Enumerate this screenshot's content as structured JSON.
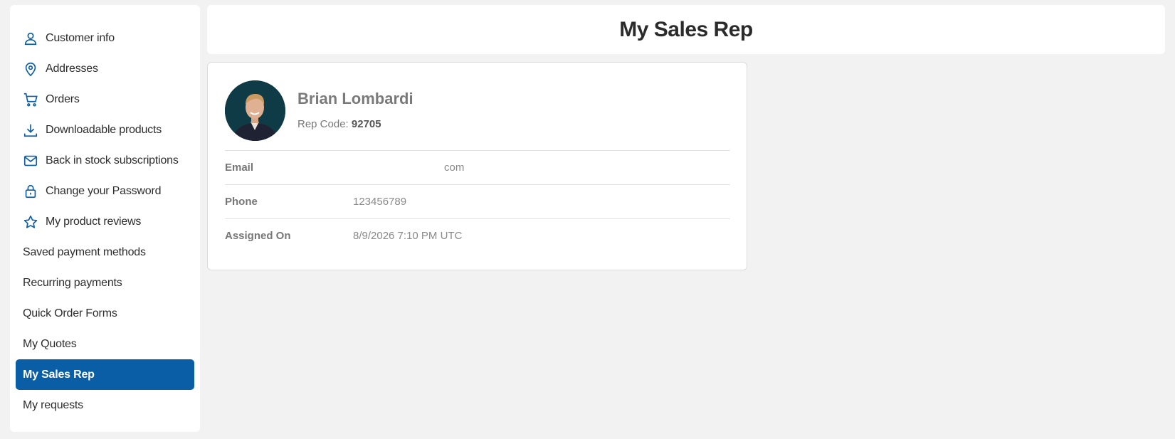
{
  "sidebar": {
    "items": [
      {
        "label": "Customer info",
        "icon": "person-icon"
      },
      {
        "label": "Addresses",
        "icon": "map-pin-icon"
      },
      {
        "label": "Orders",
        "icon": "cart-icon"
      },
      {
        "label": "Downloadable products",
        "icon": "download-icon"
      },
      {
        "label": "Back in stock subscriptions",
        "icon": "envelope-icon"
      },
      {
        "label": "Change your Password",
        "icon": "lock-icon"
      },
      {
        "label": "My product reviews",
        "icon": "star-icon"
      },
      {
        "label": "Saved payment methods",
        "icon": ""
      },
      {
        "label": "Recurring payments",
        "icon": ""
      },
      {
        "label": "Quick Order Forms",
        "icon": ""
      },
      {
        "label": "My Quotes",
        "icon": ""
      },
      {
        "label": "My Sales Rep",
        "icon": "",
        "active": true
      },
      {
        "label": "My requests",
        "icon": ""
      }
    ],
    "accent_color": "#0a5ea5"
  },
  "header": {
    "title": "My Sales Rep"
  },
  "rep": {
    "name": "Brian Lombardi",
    "code_label": "Rep Code:",
    "code": "92705",
    "details": [
      {
        "label": "Email",
        "value": "com"
      },
      {
        "label": "Phone",
        "value": "123456789"
      },
      {
        "label": "Assigned On",
        "value": "8/9/2026 7:10 PM UTC"
      }
    ]
  }
}
